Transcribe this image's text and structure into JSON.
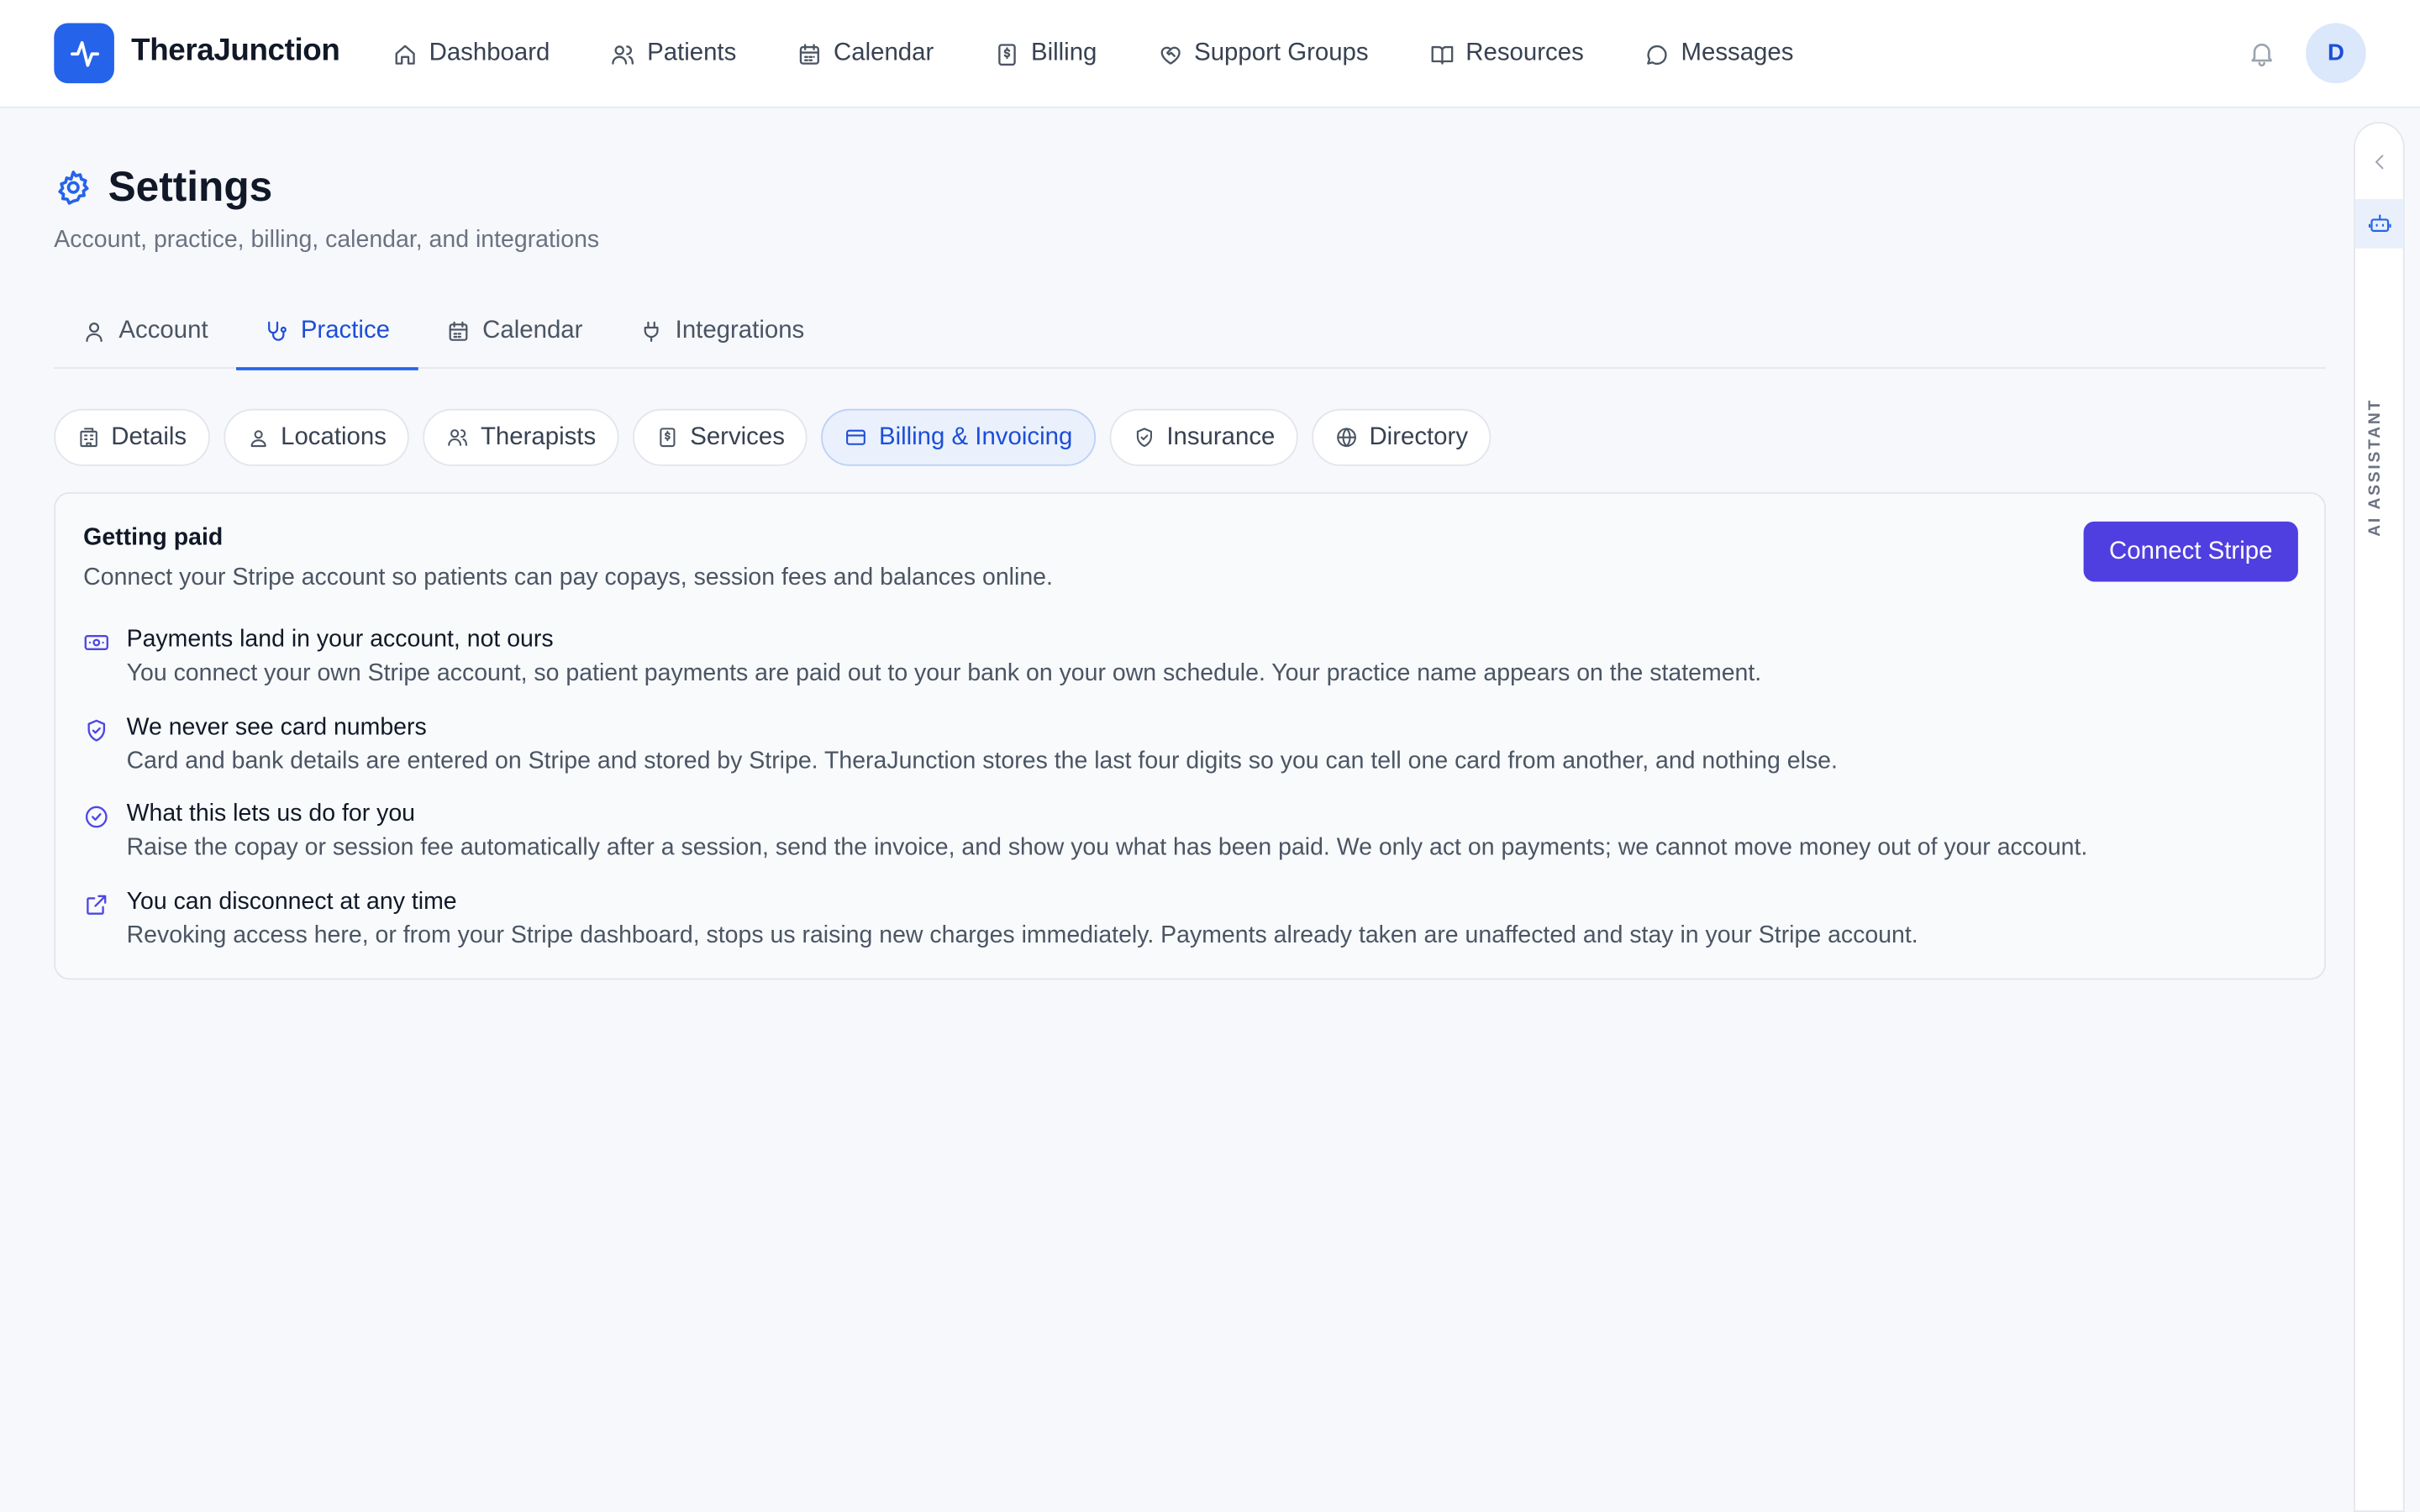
{
  "app": {
    "name": "TheraJunction"
  },
  "nav": {
    "items": [
      {
        "label": "Dashboard",
        "icon": "home-icon"
      },
      {
        "label": "Patients",
        "icon": "users-icon"
      },
      {
        "label": "Calendar",
        "icon": "calendar-icon"
      },
      {
        "label": "Billing",
        "icon": "receipt-icon"
      },
      {
        "label": "Support Groups",
        "icon": "heart-handshake-icon"
      },
      {
        "label": "Resources",
        "icon": "book-open-icon"
      },
      {
        "label": "Messages",
        "icon": "message-circle-icon"
      }
    ]
  },
  "user": {
    "avatar_initial": "D"
  },
  "page": {
    "title": "Settings",
    "subtitle": "Account, practice, billing, calendar, and integrations"
  },
  "tabs": [
    {
      "label": "Account",
      "icon": "user-icon",
      "active": false
    },
    {
      "label": "Practice",
      "icon": "stethoscope-icon",
      "active": true
    },
    {
      "label": "Calendar",
      "icon": "calendar-icon",
      "active": false
    },
    {
      "label": "Integrations",
      "icon": "plug-icon",
      "active": false
    }
  ],
  "subtabs": [
    {
      "label": "Details",
      "icon": "building-icon",
      "active": false
    },
    {
      "label": "Locations",
      "icon": "map-pin-user-icon",
      "active": false
    },
    {
      "label": "Therapists",
      "icon": "users-icon",
      "active": false
    },
    {
      "label": "Services",
      "icon": "receipt-icon",
      "active": false
    },
    {
      "label": "Billing & Invoicing",
      "icon": "credit-card-icon",
      "active": true
    },
    {
      "label": "Insurance",
      "icon": "shield-check-icon",
      "active": false
    },
    {
      "label": "Directory",
      "icon": "globe-icon",
      "active": false
    }
  ],
  "card": {
    "title": "Getting paid",
    "description": "Connect your Stripe account so patients can pay copays, session fees and balances online.",
    "button_label": "Connect Stripe",
    "features": [
      {
        "icon": "banknote-icon",
        "title": "Payments land in your account, not ours",
        "text": "You connect your own Stripe account, so patient payments are paid out to your bank on your own schedule. Your practice name appears on the statement."
      },
      {
        "icon": "shield-check-icon",
        "title": "We never see card numbers",
        "text": "Card and bank details are entered on Stripe and stored by Stripe. TheraJunction stores the last four digits so you can tell one card from another, and nothing else."
      },
      {
        "icon": "check-circle-icon",
        "title": "What this lets us do for you",
        "text": "Raise the copay or session fee automatically after a session, send the invoice, and show you what has been paid. We only act on payments; we cannot move money out of your account."
      },
      {
        "icon": "external-link-icon",
        "title": "You can disconnect at any time",
        "text": "Revoking access here, or from your Stripe dashboard, stops us raising new charges immediately. Payments already taken are unaffected and stay in your Stripe account."
      }
    ]
  },
  "assistant": {
    "label": "AI ASSISTANT"
  },
  "colors": {
    "primary": "#2563eb",
    "stripe_button": "#4f3fe0",
    "active_pill_bg": "#eaf1fd",
    "background": "#f6f8fb"
  }
}
